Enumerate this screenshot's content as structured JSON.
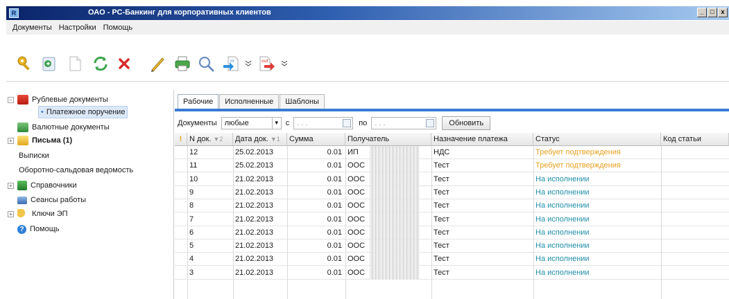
{
  "window": {
    "title": "ОАО - РС-Банкинг для корпоративных клиентов",
    "controls": [
      "_",
      "□",
      "x"
    ]
  },
  "menu": [
    "Документы",
    "Настройки",
    "Помощь"
  ],
  "toolbar": {
    "icons": [
      "key-icon",
      "template-icon",
      "new-document-icon",
      "refresh-icon",
      "delete-icon",
      "edit-icon",
      "print-icon",
      "search-icon",
      "import-icon",
      "export-icon"
    ],
    "import_label": "in",
    "export_label": "out"
  },
  "tree": [
    {
      "label": "Рублевые документы",
      "icon": "ruble-docs-icon"
    },
    {
      "label": "Платежное поручение"
    },
    {
      "label": "Валютные документы",
      "icon": "currency-docs-icon"
    },
    {
      "label": "Письма (1)",
      "icon": "letters-icon"
    },
    {
      "label": "Выписки"
    },
    {
      "label": "Оборотно-сальдовая ведомость"
    },
    {
      "label": "Справочники",
      "icon": "directories-icon"
    },
    {
      "label": "Сеансы работы",
      "icon": "sessions-icon"
    },
    {
      "label": "Ключи ЭП",
      "icon": "keys-icon"
    },
    {
      "label": "Помощь",
      "icon": "help-icon"
    }
  ],
  "tabs": [
    "Рабочие",
    "Исполненные",
    "Шаблоны"
  ],
  "filter": {
    "label": "Документы",
    "value": "любые",
    "from_label": "с",
    "to_label": "по",
    "date_placeholder": ". . .",
    "refresh_label": "Обновить"
  },
  "columns": [
    {
      "label": "!"
    },
    {
      "label": "N док.",
      "sort": "▼2"
    },
    {
      "label": "Дата док.",
      "sort": "▼1"
    },
    {
      "label": "Сумма"
    },
    {
      "label": "Получатель"
    },
    {
      "label": "Назначение платежа"
    },
    {
      "label": "Статус"
    },
    {
      "label": "Код статьи"
    }
  ],
  "rows": [
    {
      "num": "12",
      "date": "25.02.2013",
      "sum": "0.01",
      "recipient": "ИП",
      "purpose": "НДС",
      "status": "Требует подтверждения",
      "status_color": "#e8a020"
    },
    {
      "num": "11",
      "date": "25.02.2013",
      "sum": "0.01",
      "recipient": "ООС",
      "purpose": "Тест",
      "status": "Требует подтверждения",
      "status_color": "#e8a020"
    },
    {
      "num": "10",
      "date": "21.02.2013",
      "sum": "0.01",
      "recipient": "ООС",
      "purpose": "Тест",
      "status": "На исполнении",
      "status_color": "#1f8fa8"
    },
    {
      "num": "9",
      "date": "21.02.2013",
      "sum": "0.01",
      "recipient": "ООС",
      "purpose": "Тест",
      "status": "На исполнении",
      "status_color": "#1f8fa8"
    },
    {
      "num": "8",
      "date": "21.02.2013",
      "sum": "0.01",
      "recipient": "ООС",
      "purpose": "Тест",
      "status": "На исполнении",
      "status_color": "#1f8fa8"
    },
    {
      "num": "7",
      "date": "21.02.2013",
      "sum": "0.01",
      "recipient": "ООС",
      "purpose": "Тест",
      "status": "На исполнении",
      "status_color": "#1f8fa8"
    },
    {
      "num": "6",
      "date": "21.02.2013",
      "sum": "0.01",
      "recipient": "ООС",
      "purpose": "Тест",
      "status": "На исполнении",
      "status_color": "#1f8fa8"
    },
    {
      "num": "5",
      "date": "21.02.2013",
      "sum": "0.01",
      "recipient": "ООС",
      "purpose": "Тест",
      "status": "На исполнении",
      "status_color": "#1f8fa8"
    },
    {
      "num": "4",
      "date": "21.02.2013",
      "sum": "0.01",
      "recipient": "ООС",
      "purpose": "Тест",
      "status": "На исполнении",
      "status_color": "#1f8fa8"
    },
    {
      "num": "3",
      "date": "21.02.2013",
      "sum": "0.01",
      "recipient": "ООС",
      "purpose": "Тест",
      "status": "На исполнении",
      "status_color": "#1f8fa8"
    }
  ],
  "colors": {
    "titlebar": "#0a246a",
    "tab_accent": "#3a7bd5",
    "status_pending": "#e8a020",
    "status_executing": "#1f8fa8"
  }
}
